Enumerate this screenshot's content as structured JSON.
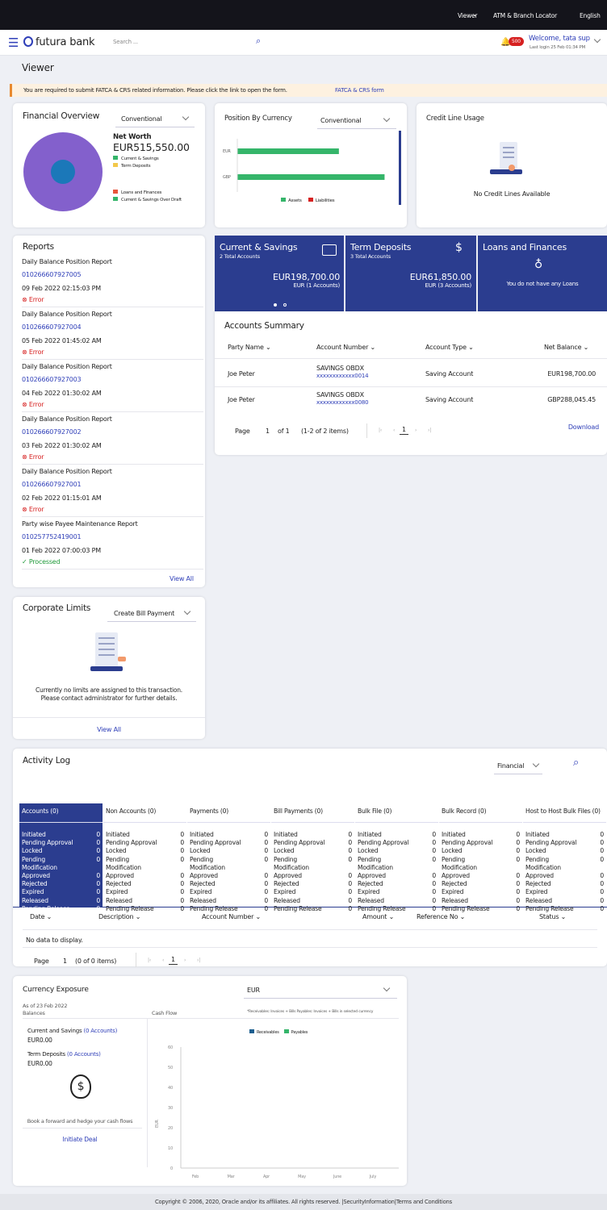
{
  "topbar": {
    "viewer": "Viewer",
    "atm": "ATM & Branch Locator",
    "lang": "English"
  },
  "header": {
    "brand": "futura bank",
    "search_placeholder": "Search ...",
    "notif_count": "500",
    "welcome": "Welcome, tata sup",
    "last_login": "Last login 25 Feb 01:34 PM"
  },
  "page": {
    "title": "Viewer",
    "banner": "You are required to submit FATCA & CRS related information. Please click the link to open the form.",
    "banner_link": "FATCA & CRS form"
  },
  "financial_overview": {
    "title": "Financial Overview",
    "dropdown": "Conventional",
    "net_worth_label": "Net Worth",
    "net_worth": "EUR515,550.00",
    "legend": [
      "Current & Savings",
      "Term Deposits",
      "Loans and Finances",
      "Current & Savings Over Draft"
    ],
    "legend_colors": [
      "#35b56a",
      "#f2c84b",
      "#e8553b",
      "#35b56a"
    ]
  },
  "position_by_currency": {
    "title": "Position By Currency",
    "dropdown": "Conventional",
    "legend": [
      "Assets",
      "Liabilities"
    ]
  },
  "credit_line": {
    "title": "Credit Line Usage",
    "empty": "No Credit Lines Available"
  },
  "reports": {
    "title": "Reports",
    "items": [
      {
        "name": "Daily Balance Position Report",
        "id": "010266607927005",
        "date": "09 Feb 2022 02:15:03 PM",
        "status": "Error"
      },
      {
        "name": "Daily Balance Position Report",
        "id": "010266607927004",
        "date": "05 Feb 2022 01:45:02 AM",
        "status": "Error"
      },
      {
        "name": "Daily Balance Position Report",
        "id": "010266607927003",
        "date": "04 Feb 2022 01:30:02 AM",
        "status": "Error"
      },
      {
        "name": "Daily Balance Position Report",
        "id": "010266607927002",
        "date": "03 Feb 2022 01:30:02 AM",
        "status": "Error"
      },
      {
        "name": "Daily Balance Position Report",
        "id": "010266607927001",
        "date": "02 Feb 2022 01:15:01 AM",
        "status": "Error"
      },
      {
        "name": "Party wise Payee Maintenance Report",
        "id": "010257752419001",
        "date": "01 Feb 2022 07:00:03 PM",
        "status": "Processed"
      }
    ],
    "view_all": "View All"
  },
  "tiles": {
    "cs_title": "Current & Savings",
    "cs_sub": "2 Total Accounts",
    "cs_amount": "EUR198,700.00",
    "cs_note": "EUR (1 Accounts)",
    "td_title": "Term Deposits",
    "td_sub": "3 Total Accounts",
    "td_amount": "EUR61,850.00",
    "td_note": "EUR (3 Accounts)",
    "lf_title": "Loans and Finances",
    "lf_note": "You do not have any Loans"
  },
  "accounts_summary": {
    "title": "Accounts Summary",
    "headers": [
      "Party Name",
      "Account Number",
      "Account Type",
      "Net Balance"
    ],
    "rows": [
      {
        "party": "Joe Peter",
        "acct_name": "SAVINGS OBDX",
        "acct_no": "xxxxxxxxxxxx0014",
        "type": "Saving Account",
        "balance": "EUR198,700.00"
      },
      {
        "party": "Joe Peter",
        "acct_name": "SAVINGS OBDX",
        "acct_no": "xxxxxxxxxxxx0080",
        "type": "Saving Account",
        "balance": "GBP288,045.45"
      }
    ],
    "page_label": "Page",
    "page": "1",
    "of": "of 1",
    "items": "(1-2 of 2 items)",
    "current": "1",
    "download": "Download"
  },
  "corporate_limits": {
    "title": "Corporate Limits",
    "dropdown": "Create Bill Payment",
    "msg1": "Currently no limits are assigned to this transaction.",
    "msg2": "Please contact administrator for further details.",
    "view_all": "View All"
  },
  "activity_log": {
    "title": "Activity Log",
    "dropdown": "Financial",
    "tabs": [
      "Accounts (0)",
      "Non Accounts (0)",
      "Payments (0)",
      "Bill Payments (0)",
      "Bulk File (0)",
      "Bulk Record (0)",
      "Host to Host Bulk Files (0)"
    ],
    "statuses": [
      "Initiated",
      "Pending Approval",
      "Locked",
      "Pending",
      "Modification",
      "Approved",
      "Rejected",
      "Expired",
      "Released",
      "Pending Release"
    ],
    "counts": [
      "0",
      "0",
      "0",
      "0",
      "",
      "0",
      "0",
      "0",
      "0",
      "0"
    ],
    "table_headers": [
      "Date",
      "Description",
      "Account Number",
      "Amount",
      "Reference No",
      "Status"
    ],
    "empty": "No data to display.",
    "page_label": "Page",
    "page": "1",
    "items": "(0 of 0 items)",
    "current": "1"
  },
  "currency_exposure": {
    "title": "Currency Exposure",
    "currency": "EUR",
    "as_of": "As of 23 Feb 2022",
    "balances": "Balances",
    "cash_flow": "Cash Flow",
    "note": "*Receivables: Invoices + Bills  Payables: Invoices + Bills  in selected currency",
    "cs_label": "Current and Savings",
    "cs_link": "(0 Accounts)",
    "cs_amount": "EUR0.00",
    "td_label": "Term Deposits",
    "td_link": "(0 Accounts)",
    "td_amount": "EUR0.00",
    "hedge": "Book a forward and hedge your cash flows",
    "initiate": "Initiate Deal",
    "legend": [
      "Receivables",
      "Payables"
    ],
    "ylabel": "EUR"
  },
  "chart_data": [
    {
      "type": "bar",
      "title": "Position By Currency",
      "categories": [
        "EUR",
        "GBP"
      ],
      "series": [
        {
          "name": "Assets",
          "values": [
            198700,
            288045.45
          ]
        },
        {
          "name": "Liabilities",
          "values": [
            0,
            0
          ]
        }
      ]
    },
    {
      "type": "pie",
      "title": "Financial Overview",
      "series": [
        {
          "name": "Current & Savings",
          "values": [
            1
          ]
        }
      ]
    },
    {
      "type": "bar",
      "title": "",
      "categories": [
        "Feb",
        "Mar",
        "Apr",
        "May",
        "June",
        "July"
      ],
      "series": [
        {
          "name": "Receivables",
          "values": [
            0,
            0,
            0,
            0,
            0,
            0
          ]
        },
        {
          "name": "Payables",
          "values": [
            0,
            0,
            0,
            0,
            0,
            0
          ]
        }
      ],
      "ylim": [
        0,
        60
      ],
      "yticks": [
        "0",
        "10",
        "20",
        "30",
        "40",
        "50",
        "60"
      ],
      "ylabel": "EUR"
    }
  ],
  "footer": "Copyright © 2006, 2020, Oracle and/or its affiliates. All rights reserved. |SecurityInformation|Terms and Conditions"
}
